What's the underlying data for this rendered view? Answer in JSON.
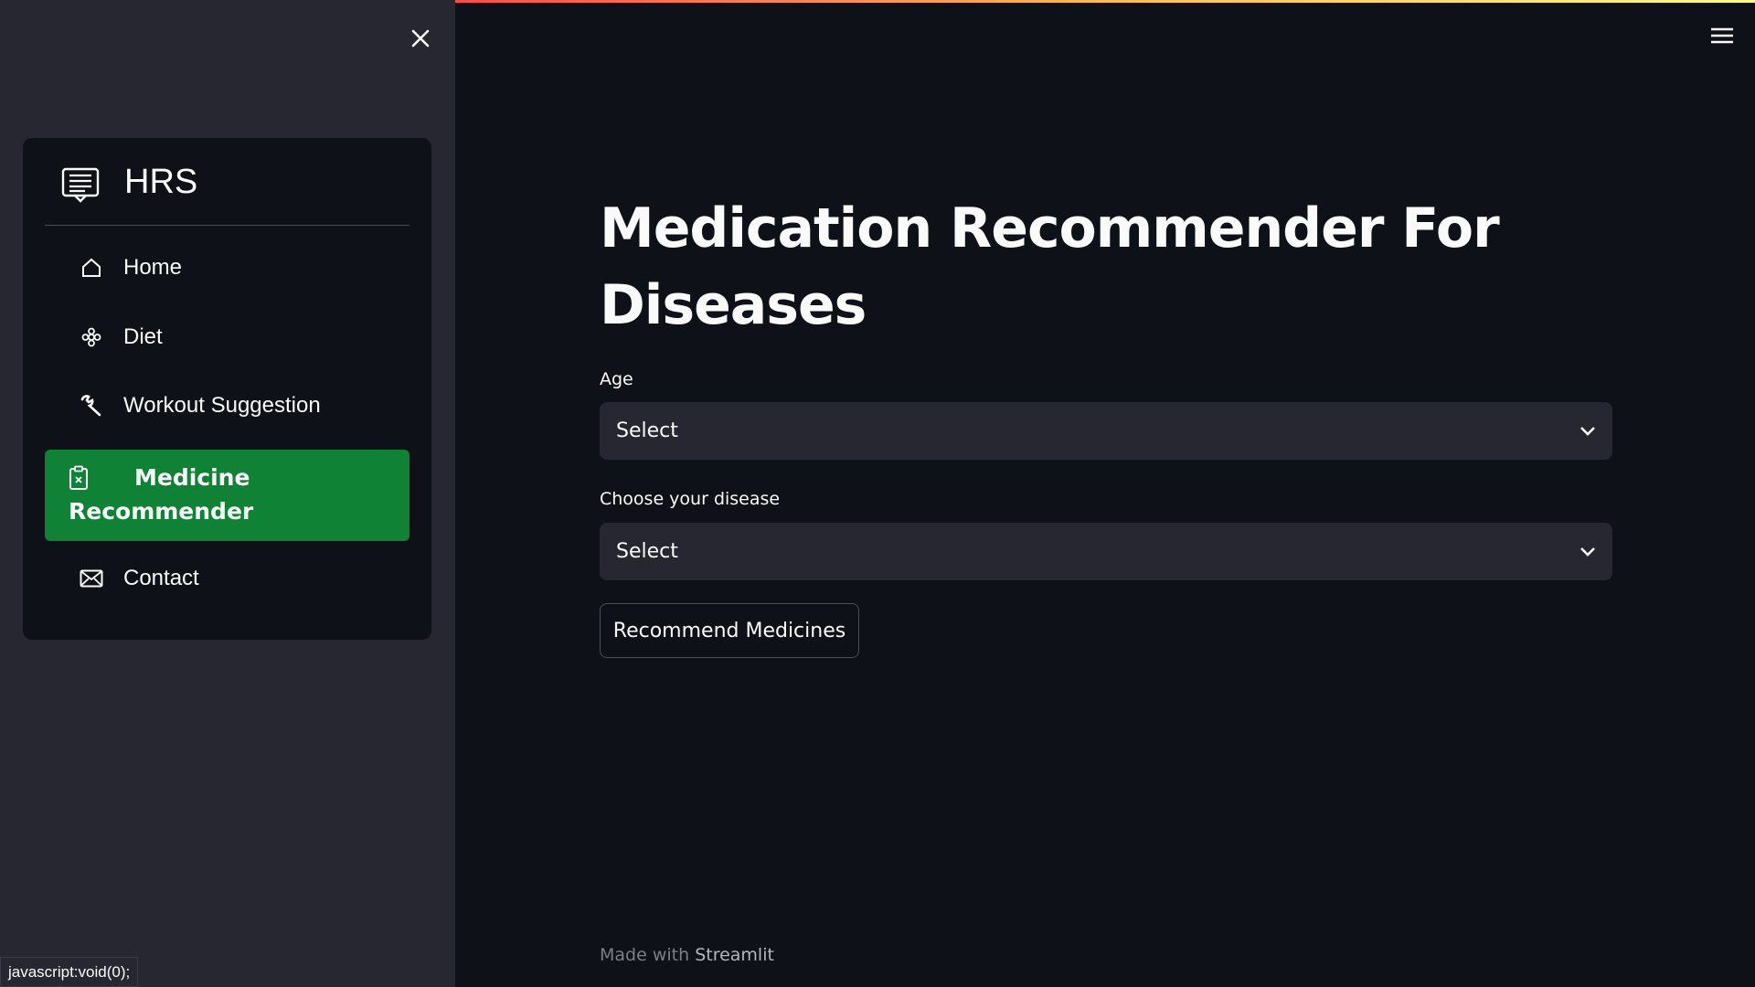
{
  "sidebar": {
    "menu_title": "HRS",
    "items": [
      {
        "label": "Home",
        "icon": "home-icon"
      },
      {
        "label": "Diet",
        "icon": "flower-icon"
      },
      {
        "label": "Workout Suggestion",
        "icon": "wrench-icon"
      },
      {
        "label": "Medicine Recommender",
        "icon": "clipboard-x-icon",
        "active": true
      },
      {
        "label": "Contact",
        "icon": "envelope-icon"
      }
    ],
    "active_color": "#0f8236"
  },
  "main": {
    "title": "Medication Recommender For Diseases",
    "age_label": "Age",
    "age_value": "Select",
    "disease_label": "Choose your disease",
    "disease_value": "Select",
    "button_label": "Recommend Medicines"
  },
  "footer": {
    "prefix": "Made with",
    "brand": "Streamlit"
  },
  "statusbar": {
    "text": "javascript:void(0);"
  }
}
